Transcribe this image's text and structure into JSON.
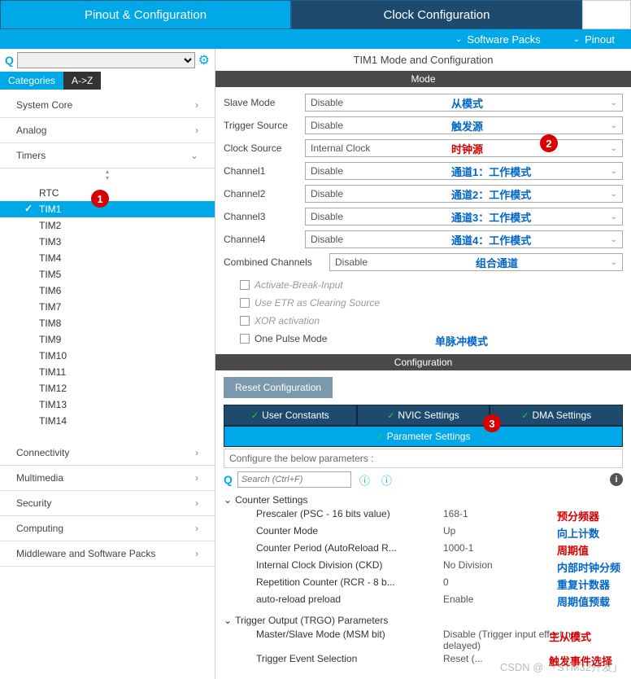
{
  "topTabs": {
    "pinout": "Pinout & Configuration",
    "clock": "Clock Configuration"
  },
  "subBar": {
    "software": "Software Packs",
    "pinout": "Pinout"
  },
  "catTabs": {
    "categories": "Categories",
    "az": "A->Z"
  },
  "tree": {
    "systemCore": "System Core",
    "analog": "Analog",
    "timers": "Timers",
    "timerItems": [
      "RTC",
      "TIM1",
      "TIM2",
      "TIM3",
      "TIM4",
      "TIM5",
      "TIM6",
      "TIM7",
      "TIM8",
      "TIM9",
      "TIM10",
      "TIM11",
      "TIM12",
      "TIM13",
      "TIM14"
    ],
    "connectivity": "Connectivity",
    "multimedia": "Multimedia",
    "security": "Security",
    "computing": "Computing",
    "middleware": "Middleware and Software Packs"
  },
  "rightHeader": "TIM1 Mode and Configuration",
  "modeTitle": "Mode",
  "mode": {
    "slaveLabel": "Slave Mode",
    "slaveVal": "Disable",
    "slaveAnno": "从模式",
    "trigLabel": "Trigger Source",
    "trigVal": "Disable",
    "trigAnno": "触发源",
    "clockLabel": "Clock Source",
    "clockVal": "Internal Clock",
    "clockAnno": "时钟源",
    "ch1Label": "Channel1",
    "ch1Val": "Disable",
    "ch1Anno": "通道1：工作模式",
    "ch2Label": "Channel2",
    "ch2Val": "Disable",
    "ch2Anno": "通道2：工作模式",
    "ch3Label": "Channel3",
    "ch3Val": "Disable",
    "ch3Anno": "通道3：工作模式",
    "ch4Label": "Channel4",
    "ch4Val": "Disable",
    "ch4Anno": "通道4：工作模式",
    "combLabel": "Combined Channels",
    "combVal": "Disable",
    "combAnno": "组合通道",
    "abi": "Activate-Break-Input",
    "etr": "Use ETR as Clearing Source",
    "xor": "XOR activation",
    "opm": "One Pulse Mode",
    "opmAnno": "单脉冲模式"
  },
  "configTitle": "Configuration",
  "resetBtn": "Reset Configuration",
  "cfgTabs": {
    "user": "User Constants",
    "nvic": "NVIC Settings",
    "dma": "DMA Settings",
    "param": "Parameter Settings"
  },
  "paramHint": "Configure the below parameters :",
  "searchPlaceholder": "Search (Ctrl+F)",
  "params": {
    "counterGroup": "Counter Settings",
    "psc": {
      "l": "Prescaler (PSC - 16 bits value)",
      "v": "168-1",
      "a": "预分频器"
    },
    "cmode": {
      "l": "Counter Mode",
      "v": "Up",
      "a": "向上计数"
    },
    "period": {
      "l": "Counter Period (AutoReload R...",
      "v": "1000-1",
      "a": "周期值"
    },
    "ckd": {
      "l": "Internal Clock Division (CKD)",
      "v": "No Division",
      "a": "内部时钟分频"
    },
    "rcr": {
      "l": "Repetition Counter (RCR - 8 b...",
      "v": "0",
      "a": "重复计数器"
    },
    "preload": {
      "l": "auto-reload preload",
      "v": "Enable",
      "a": "周期值预载"
    },
    "trgoGroup": "Trigger Output (TRGO) Parameters",
    "msm": {
      "l": "Master/Slave Mode (MSM bit)",
      "v": "Disable (Trigger input effect not delayed)",
      "a": "主从模式"
    },
    "tes": {
      "l": "Trigger Event Selection",
      "v": "Reset (...",
      "a": "触发事件选择"
    }
  },
  "badges": {
    "b1": "1",
    "b2": "2",
    "b3": "3"
  },
  "watermark": "CSDN @ 「STM32开发」"
}
